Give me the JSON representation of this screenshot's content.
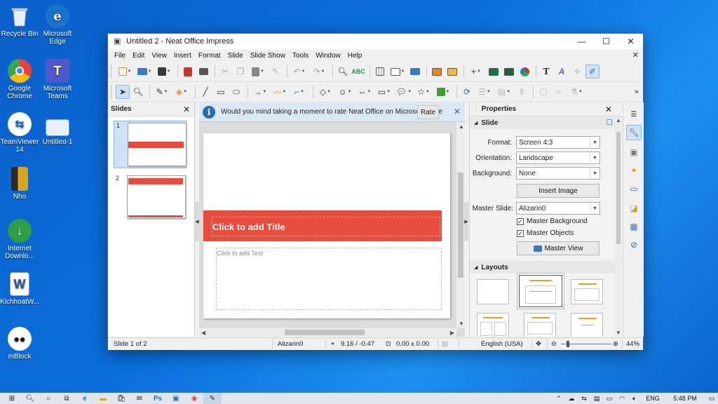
{
  "desktop": {
    "icons": [
      {
        "label": "Recycle Bin",
        "color": "#cfd8e3"
      },
      {
        "label": "Microsoft Edge",
        "color": "#1a73c9"
      },
      {
        "label": "Google Chrome",
        "color": "#ea4335"
      },
      {
        "label": "Microsoft Teams",
        "color": "#5059c9"
      },
      {
        "label": "TeamViewer 14",
        "color": "#0e63c9"
      },
      {
        "label": "Untitled-1",
        "color": "#2d7ad8"
      },
      {
        "label": "Nho",
        "color": "#d9a520"
      },
      {
        "label": "Internet Downlo...",
        "color": "#2f9e44"
      },
      {
        "label": "KichhoatW...",
        "color": "#2b579a"
      },
      {
        "label": "mBlock",
        "color": "#ffffff"
      }
    ]
  },
  "window": {
    "title": "Untitled 2 - Neat Office Impress",
    "controls": {
      "minimize": "—",
      "maximize": "☐",
      "close": "✕"
    }
  },
  "menu": {
    "items": [
      "File",
      "Edit",
      "View",
      "Insert",
      "Format",
      "Slide",
      "Slide Show",
      "Tools",
      "Window",
      "Help"
    ],
    "close": "✕"
  },
  "slides_panel": {
    "title": "Slides",
    "close": "✕",
    "slides": [
      {
        "number": "1",
        "selected": true
      },
      {
        "number": "2",
        "selected": false
      }
    ]
  },
  "infobar": {
    "message": "Would you mind taking a moment to rate Neat Office on Microsoft Store",
    "button": "Rate",
    "close": "✕",
    "icon": "i"
  },
  "slide": {
    "title_placeholder": "Click to add Title",
    "text_placeholder": "Click to add Text",
    "accent": "#e74c3c"
  },
  "properties": {
    "title": "Properties",
    "close": "✕",
    "slide_section": "Slide",
    "format_label": "Format:",
    "format_value": "Screen 4:3",
    "orientation_label": "Orientation:",
    "orientation_value": "Landscape",
    "background_label": "Background:",
    "background_value": "None",
    "insert_image": "Insert Image",
    "master_slide_label": "Master Slide:",
    "master_slide_value": "Alizarin0",
    "master_background": "Master Background",
    "master_objects": "Master Objects",
    "master_view": "Master View",
    "layouts_section": "Layouts"
  },
  "statusbar": {
    "slide_info": "Slide 1 of 2",
    "master": "Alizarin0",
    "position": "9.16 / -0.47",
    "size": "0.00 x 0.00",
    "language": "English (USA)",
    "zoom": "44%",
    "zoom_level": 0.44
  },
  "taskbar": {
    "lang": "ENG",
    "time": "5:48 PM"
  }
}
